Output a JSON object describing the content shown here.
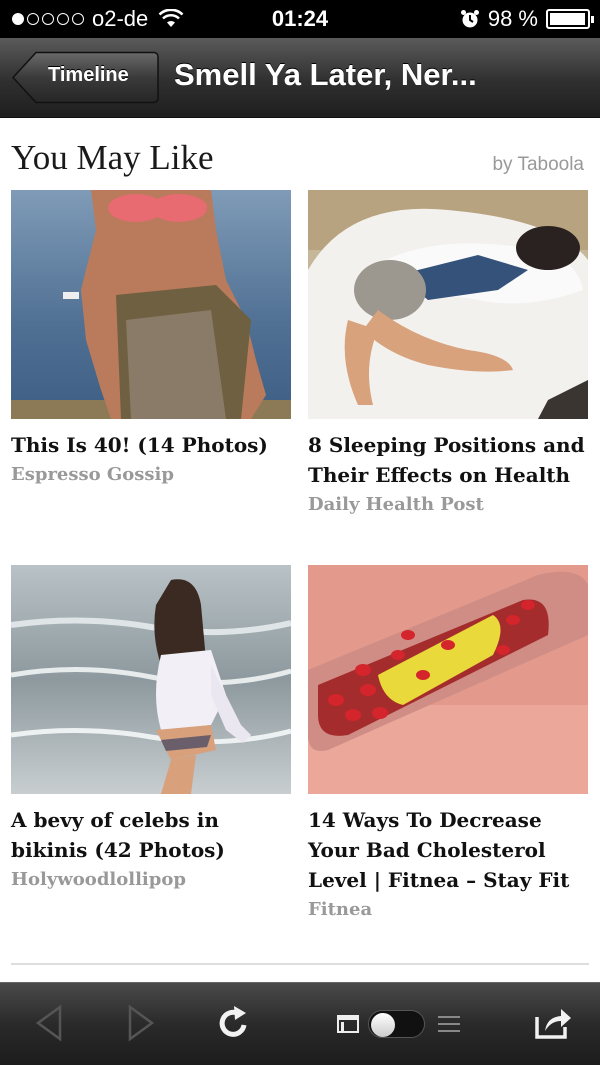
{
  "status_bar": {
    "carrier": "o2-de",
    "time": "01:24",
    "battery": "98 %",
    "battery_level": 0.98,
    "signal_bars_filled": 1,
    "icons": [
      "signal-dots-icon",
      "wifi-icon",
      "alarm-icon",
      "battery-icon"
    ]
  },
  "nav": {
    "back_label": "Timeline",
    "title": "Smell Ya Later, Ner..."
  },
  "widget": {
    "heading": "You May Like",
    "attribution": "by Taboola"
  },
  "cards": [
    {
      "title": "This Is 40! (14 Photos)",
      "source": "Espresso Gossip",
      "image": "woman-bikini-beach-photo"
    },
    {
      "title": "8 Sleeping Positions and Their Effects on Health",
      "source": "Daily Health Post",
      "image": "woman-sleeping-pillow-photo"
    },
    {
      "title": "A bevy of celebs in bikinis (42 Photos)",
      "source": "Holywoodlollipop",
      "image": "woman-surf-beach-photo"
    },
    {
      "title": "14 Ways To Decrease Your Bad Cholesterol Level | Fitnea – Stay Fit",
      "source": "Fitnea",
      "image": "artery-cholesterol-illustration"
    }
  ],
  "toolbar": {
    "icons": [
      "back-arrow-icon",
      "forward-arrow-icon",
      "reload-icon",
      "reader-icon",
      "toggle-switch",
      "list-icon",
      "share-icon"
    ],
    "toggle_on": false
  },
  "colors": {
    "navbar": "#2f2f2f",
    "source_text": "#999999",
    "title_text": "#111111"
  }
}
